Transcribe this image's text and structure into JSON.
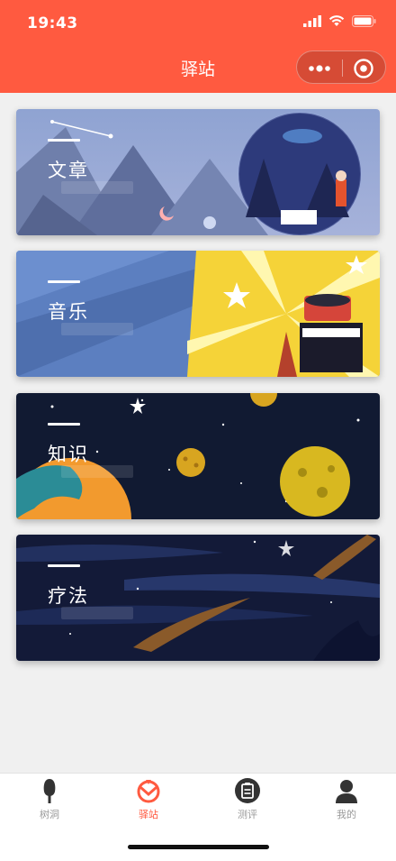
{
  "status_bar": {
    "time": "19:43"
  },
  "nav": {
    "title": "驿站",
    "more_icon": "more-dots-icon",
    "close_icon": "target-circle-icon"
  },
  "cards": [
    {
      "label": "文章"
    },
    {
      "label": "音乐"
    },
    {
      "label": "知识"
    },
    {
      "label": "疗法"
    }
  ],
  "tabs": [
    {
      "label": "树洞",
      "icon": "tree-icon",
      "active": false
    },
    {
      "label": "驿站",
      "icon": "station-icon",
      "active": true
    },
    {
      "label": "测评",
      "icon": "clipboard-icon",
      "active": false
    },
    {
      "label": "我的",
      "icon": "person-icon",
      "active": false
    }
  ],
  "colors": {
    "header": "#ff5a40",
    "active_tab": "#ff5a40",
    "inactive_tab": "#999999"
  }
}
